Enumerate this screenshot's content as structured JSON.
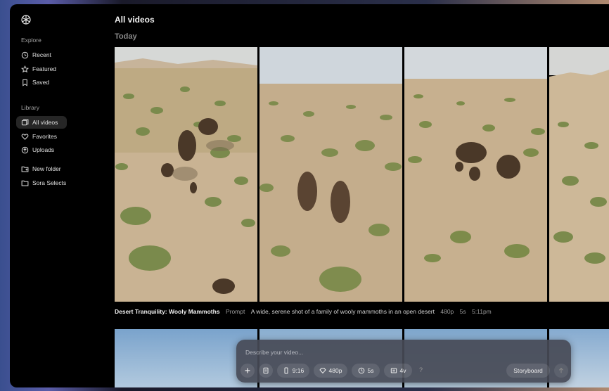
{
  "sidebar": {
    "explore_label": "Explore",
    "explore_items": [
      {
        "label": "Recent",
        "icon": "clock-icon"
      },
      {
        "label": "Featured",
        "icon": "star-icon"
      },
      {
        "label": "Saved",
        "icon": "bookmark-icon"
      }
    ],
    "library_label": "Library",
    "library_items": [
      {
        "label": "All videos",
        "icon": "video-grid-icon",
        "active": true
      },
      {
        "label": "Favorites",
        "icon": "heart-icon"
      },
      {
        "label": "Uploads",
        "icon": "upload-icon"
      }
    ],
    "folder_items": [
      {
        "label": "New folder",
        "icon": "folder-plus-icon"
      },
      {
        "label": "Sora Selects",
        "icon": "folder-icon"
      }
    ]
  },
  "main": {
    "title": "All videos",
    "group_label": "Today",
    "video": {
      "title": "Desert Tranquility: Wooly Mammoths",
      "prompt_label": "Prompt",
      "prompt": "A wide, serene shot of a family of wooly mammoths in an open desert",
      "resolution": "480p",
      "duration": "5s",
      "time": "5:11pm"
    }
  },
  "composer": {
    "placeholder": "Describe your video...",
    "aspect": "9:16",
    "resolution": "480p",
    "duration": "5s",
    "variations": "4v",
    "help": "?",
    "storyboard": "Storyboard"
  },
  "colors": {
    "background": "#000000",
    "sky": "#cfd6dc",
    "sand": "#c9b393",
    "brush": "#7f8c4e",
    "composer": "#464a56"
  }
}
